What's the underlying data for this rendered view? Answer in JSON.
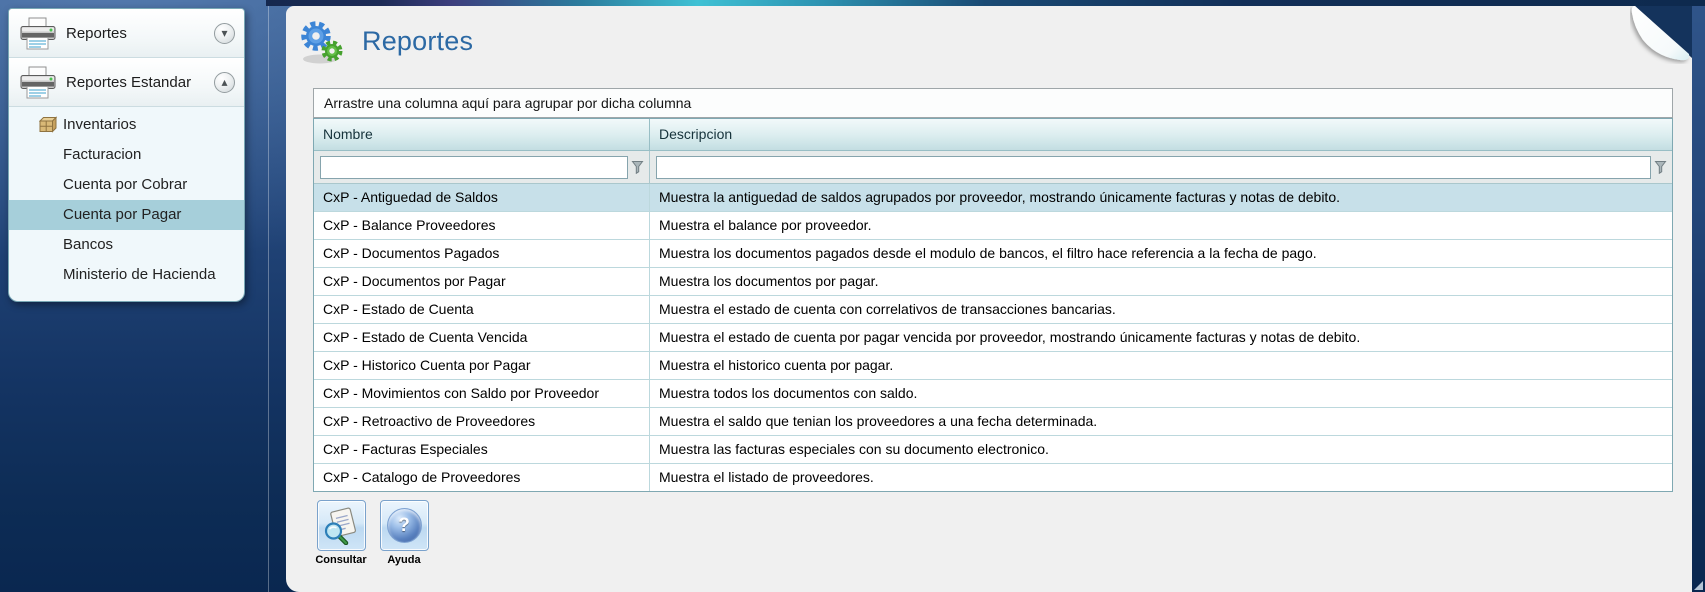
{
  "sidebar": {
    "groups": [
      {
        "label": "Reportes",
        "expander_icon": "arrow-down-circle-icon",
        "expander_glyph": "▾",
        "expanded": false
      },
      {
        "label": "Reportes Estandar",
        "expander_icon": "arrow-up-circle-icon",
        "expander_glyph": "▴",
        "expanded": true
      }
    ],
    "items": [
      {
        "label": "Inventarios",
        "icon": "crate-icon",
        "selected": false
      },
      {
        "label": "Facturacion",
        "selected": false
      },
      {
        "label": "Cuenta por Cobrar",
        "selected": false
      },
      {
        "label": "Cuenta por Pagar",
        "selected": true
      },
      {
        "label": "Bancos",
        "selected": false
      },
      {
        "label": "Ministerio de Hacienda",
        "selected": false
      }
    ]
  },
  "main": {
    "title": "Reportes",
    "title_icon": "gears-icon",
    "group_bar_text": "Arrastre una columna aquí para agrupar por dicha columna",
    "table": {
      "columns": [
        {
          "label": "Nombre"
        },
        {
          "label": "Descripcion"
        }
      ],
      "filters": [
        {
          "value": "",
          "placeholder": "",
          "icon": "filter-funnel-icon"
        },
        {
          "value": "",
          "placeholder": "",
          "icon": "filter-funnel-icon"
        }
      ],
      "rows": [
        {
          "name": "CxP - Antiguedad de Saldos",
          "description": "Muestra la antiguedad de saldos agrupados por proveedor, mostrando únicamente facturas y notas de debito.",
          "selected": true
        },
        {
          "name": "CxP - Balance Proveedores",
          "description": "Muestra el balance por proveedor.",
          "selected": false
        },
        {
          "name": "CxP - Documentos Pagados",
          "description": "Muestra los documentos pagados desde el modulo de bancos, el filtro hace referencia a la fecha de pago.",
          "selected": false
        },
        {
          "name": "CxP - Documentos por Pagar",
          "description": "Muestra los documentos por pagar.",
          "selected": false
        },
        {
          "name": "CxP - Estado de Cuenta",
          "description": "Muestra el estado de cuenta con correlativos de transacciones bancarias.",
          "selected": false
        },
        {
          "name": "CxP - Estado de Cuenta Vencida",
          "description": "Muestra el estado de cuenta por pagar vencida por proveedor, mostrando únicamente facturas y notas de debito.",
          "selected": false
        },
        {
          "name": "CxP - Historico Cuenta por Pagar",
          "description": "Muestra el historico cuenta por pagar.",
          "selected": false
        },
        {
          "name": "CxP - Movimientos con Saldo por Proveedor",
          "description": "Muestra todos los documentos con saldo.",
          "selected": false
        },
        {
          "name": "CxP - Retroactivo de Proveedores",
          "description": "Muestra el saldo que tenian los proveedores a una fecha determinada.",
          "selected": false
        },
        {
          "name": "CxP - Facturas Especiales",
          "description": "Muestra las facturas especiales con su documento electronico.",
          "selected": false
        },
        {
          "name": "CxP - Catalogo de Proveedores",
          "description": "Muestra el listado de proveedores.",
          "selected": false
        }
      ]
    },
    "buttons": [
      {
        "label": "Consultar",
        "icon": "search-document-icon"
      },
      {
        "label": "Ayuda",
        "icon": "help-icon",
        "glyph": "?"
      }
    ]
  },
  "colors": {
    "title_blue": "#2c69a4",
    "selected_nav_item": "#a6cfda",
    "selected_table_row": "#c7e0e9",
    "table_header_teal": "#c3dee2",
    "desktop_navy": "#0d2c55"
  }
}
